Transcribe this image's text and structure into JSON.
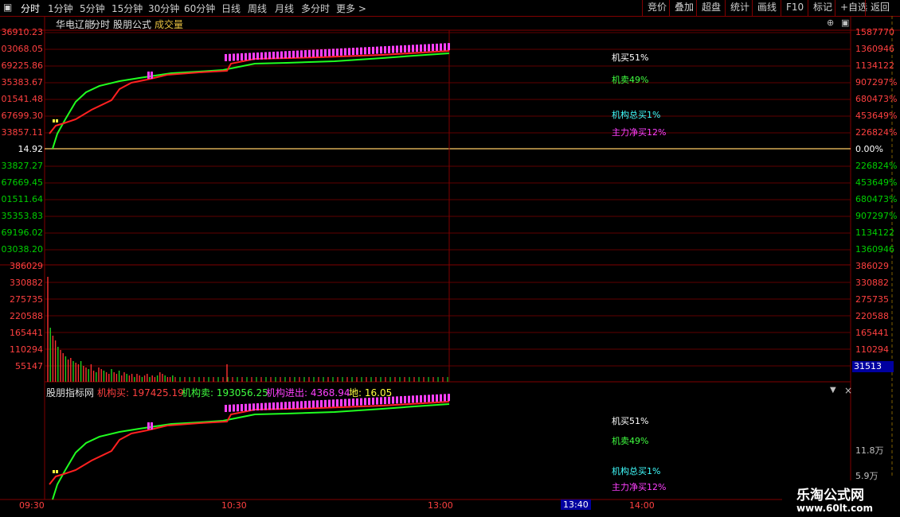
{
  "toolbar": {
    "menu_icon": "menu-icon",
    "periods": [
      "分时",
      "1分钟",
      "5分钟",
      "15分钟",
      "30分钟",
      "60分钟",
      "日线",
      "周线",
      "月线",
      "多分时",
      "更多 >"
    ],
    "right_buttons": [
      "竞价",
      "叠加",
      "超盘",
      "统计",
      "画线",
      "F10",
      "标记",
      "+自选",
      "返回"
    ]
  },
  "header": {
    "stock_name": "华电辽能",
    "tabs": [
      "分时",
      "股朋公式",
      "成交量"
    ]
  },
  "price_axis": {
    "left": [
      "36910.23",
      "03068.05",
      "69225.86",
      "35383.67",
      "01541.48",
      "67699.30",
      "33857.11",
      "14.92",
      "33827.27",
      "67669.45",
      "01511.64",
      "35353.83",
      "69196.02",
      "03038.20"
    ],
    "right": [
      "1587770",
      "1360946",
      "1134122",
      "907297%",
      "680473%",
      "453649%",
      "226824%",
      "0.00%",
      "226824%",
      "453649%",
      "680473%",
      "907297%",
      "1134122",
      "1360946"
    ]
  },
  "volume_axis": {
    "left": [
      "386029",
      "330882",
      "275735",
      "220588",
      "165441",
      "110294",
      "55147"
    ],
    "right": [
      "386029",
      "330882",
      "275735",
      "220588",
      "165441",
      "110294"
    ],
    "current_volume": "31513"
  },
  "indicator": {
    "name": "股朋指标网",
    "items": [
      {
        "label": "机构买: 197425.19",
        "color": "#ff4040"
      },
      {
        "label": "机构卖: 193056.25",
        "color": "#40ff40"
      },
      {
        "label": "机构进出: 4368.94",
        "color": "#ff40ff"
      },
      {
        "label": "地: 16.05",
        "color": "#ffff40"
      }
    ],
    "right_axis": [
      "11.8万",
      "5.9万"
    ]
  },
  "annotations": {
    "buy": "机买51%",
    "sell": "机卖49%",
    "inst_buy": "机构总买1%",
    "main_net": "主力净买12%"
  },
  "time_axis": {
    "labels": [
      "09:30",
      "10:30",
      "13:00",
      "14:00"
    ],
    "cursor": "13:40"
  },
  "watermark": {
    "title": "乐淘公式网",
    "url": "www.60lt.com"
  },
  "colors": {
    "grid": "#800000",
    "price_line": "#ff2020",
    "avg_line": "#20ff20",
    "magenta": "#ff40ff",
    "zero_line": "#ffcc66"
  }
}
